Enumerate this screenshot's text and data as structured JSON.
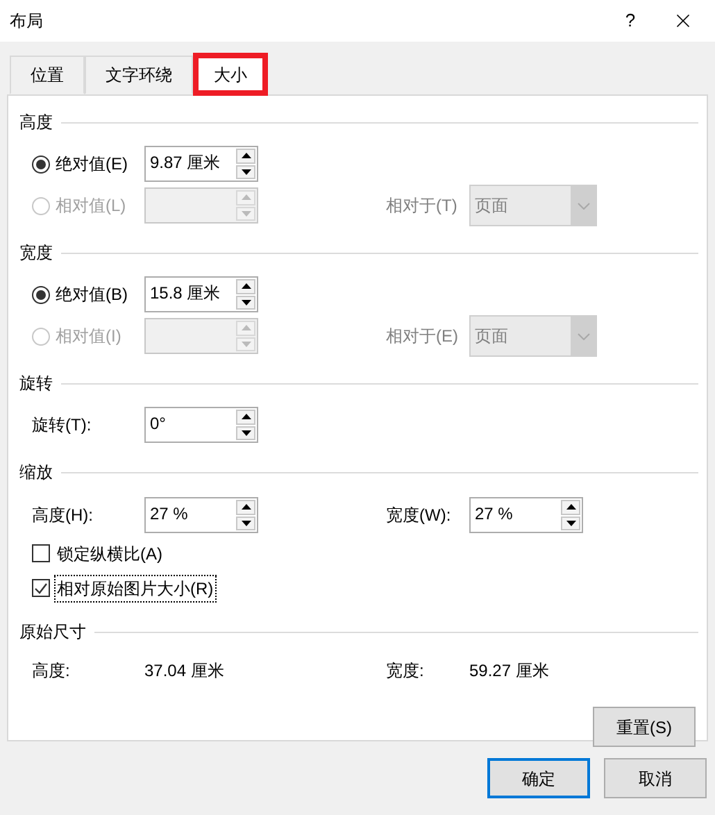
{
  "window": {
    "title": "布局",
    "help": "?"
  },
  "tabs": [
    {
      "label": "位置",
      "selected": false,
      "highlighted": false
    },
    {
      "label": "文字环绕",
      "selected": false,
      "highlighted": false
    },
    {
      "label": "大小",
      "selected": true,
      "highlighted": true
    }
  ],
  "sections": [
    {
      "title": "高度",
      "kind": "size",
      "absolute": {
        "label": "绝对值(E)",
        "selected": true,
        "disabled": false,
        "value": "9.87 厘米"
      },
      "relative": {
        "label": "相对值(L)",
        "selected": false,
        "disabled": true
      },
      "relative_to": {
        "label": "相对于(T)",
        "value": "页面",
        "disabled": true
      }
    },
    {
      "title": "宽度",
      "kind": "size",
      "absolute": {
        "label": "绝对值(B)",
        "selected": true,
        "disabled": false,
        "value": "15.8 厘米"
      },
      "relative": {
        "label": "相对值(I)",
        "selected": false,
        "disabled": true
      },
      "relative_to": {
        "label": "相对于(E)",
        "value": "页面",
        "disabled": true
      }
    },
    {
      "title": "旋转",
      "kind": "rotation",
      "label": "旋转(T):",
      "value": "0°"
    },
    {
      "title": "缩放",
      "kind": "scale",
      "height": {
        "label": "高度(H):",
        "value": "27 %"
      },
      "width": {
        "label": "宽度(W):",
        "value": "27 %"
      },
      "checkboxes": [
        {
          "label": "锁定纵横比(A)",
          "checked": false,
          "focused": false
        },
        {
          "label": "相对原始图片大小(R)",
          "checked": true,
          "focused": true
        }
      ]
    },
    {
      "title": "原始尺寸",
      "kind": "original",
      "height": {
        "label": "高度:",
        "value": "37.04 厘米"
      },
      "width": {
        "label": "宽度:",
        "value": "59.27 厘米"
      },
      "button": "重置(S)"
    }
  ],
  "buttons": [
    {
      "label": "确定",
      "default": true
    },
    {
      "label": "取消",
      "default": false
    }
  ]
}
